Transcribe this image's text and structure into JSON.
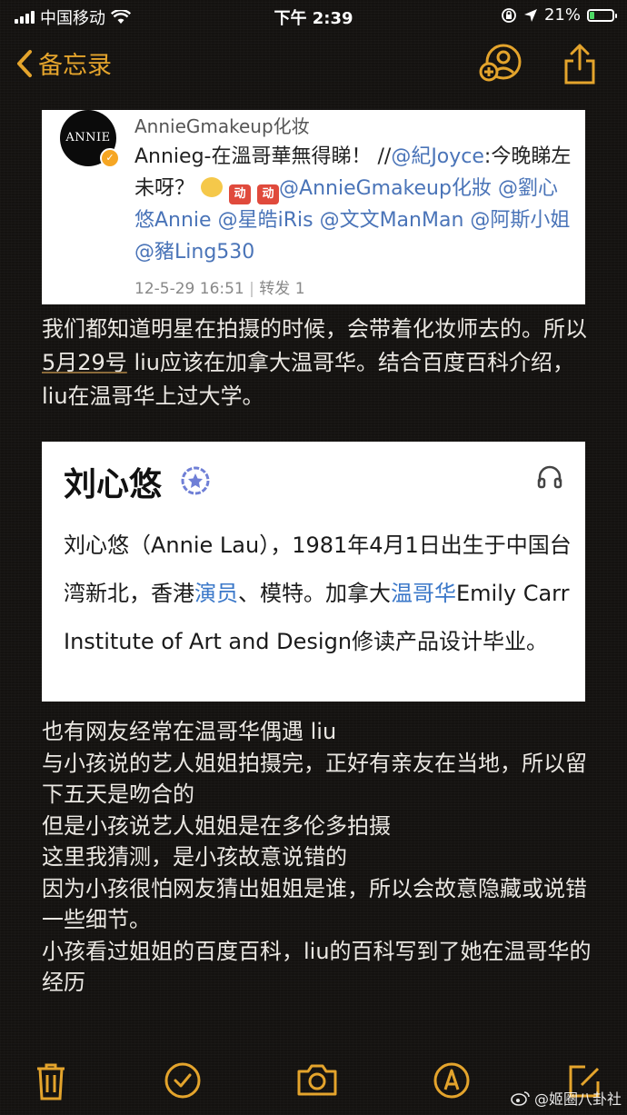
{
  "status_bar": {
    "carrier": "中国移动",
    "time": "下午 2:39",
    "battery": "21%",
    "battery_level": 0.21
  },
  "nav": {
    "back_label": "备忘录"
  },
  "weibo_card": {
    "avatar_text": "ANNIE G",
    "account_name": "AnnieGmakeup化妆",
    "text_a": "Annieg-在溫哥華無得睇！ //",
    "mention_1": "@紀Joyce",
    "text_b": ":今晚睇左未呀？",
    "emoji_1": "sunny-face-emoji",
    "emoji_2": "red-stamp-emoji",
    "emoji_3": "red-stamp-emoji",
    "mention_2": "@AnnieGmakeup化妝",
    "mention_3": "@劉心悠Annie",
    "mention_4": "@星皓iRis",
    "mention_5": "@文文ManMan",
    "mention_6": "@阿斯小姐",
    "mention_7": "@豬Ling530",
    "timestamp": "12-5-29 16:51",
    "repost": "转发 1"
  },
  "paragraph_1": {
    "before": "我们都知道明星在拍摄的时候，会带着化妆师去的。所以",
    "underlined": "5月29号",
    "after": " liu应该在加拿大温哥华。结合百度百科介绍，liu在温哥华上过大学。"
  },
  "baike_card": {
    "title": "刘心悠",
    "text_a": "刘心悠（Annie Lau），1981年4月1日出生于中国台湾新北，香港",
    "link_1": "演员",
    "text_b": "、模特。加拿大",
    "link_2": "温哥华",
    "text_c": "Emily Carr Institute of Art and Design修读产品设计毕业。"
  },
  "paragraph_2": {
    "lines": [
      "也有网友经常在温哥华偶遇 liu",
      "与小孩说的艺人姐姐拍摄完，正好有亲友在当地，所以留下五天是吻合的",
      "但是小孩说艺人姐姐是在多伦多拍摄",
      "这里我猜测，是小孩故意说错的",
      "因为小孩很怕网友猜出姐姐是谁，所以会故意隐藏或说错一些细节。",
      "小孩看过姐姐的百度百科，liu的百科写到了她在温哥华的经历"
    ]
  },
  "watermark": "@姬圈八卦社",
  "colors": {
    "accent": "#e4a42c",
    "background": "#141210",
    "link": "#4a74b8"
  }
}
